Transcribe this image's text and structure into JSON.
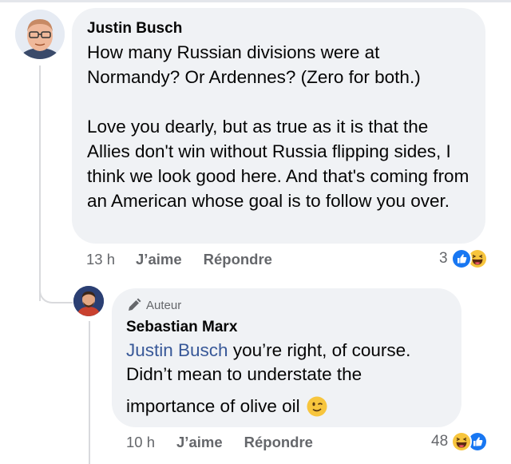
{
  "comments": [
    {
      "author": "Justin Busch",
      "paragraphs": [
        "How many Russian divisions were at Normandy? Or Ardennes? (Zero for both.)",
        "Love you dearly, but as true as it is that the Allies don't win without Russia flipping sides, I think we look good here. And that's coming from an American whose goal is to follow you over."
      ],
      "time": "13 h",
      "like_label": "J’aime",
      "reply_label": "Répondre",
      "reaction_count": "3",
      "reactions": [
        "like-icon",
        "haha-icon"
      ]
    }
  ],
  "reply": {
    "badge": "Auteur",
    "badge_icon": "pencil-icon",
    "author": "Sebastian Marx",
    "mention": "Justin Busch",
    "text_line1": " you’re right, of course.",
    "text_line2": "Didn’t mean to understate the",
    "text_line3": "importance of olive oil",
    "emoji": "wink-emoji-icon",
    "time": "10 h",
    "like_label": "J’aime",
    "reply_label": "Répondre",
    "reaction_count": "48",
    "reactions": [
      "haha-icon",
      "like-icon"
    ]
  },
  "colors": {
    "bubble": "#f0f2f5",
    "meta_text": "#65676b",
    "mention": "#385898",
    "like_blue": "#1877f2",
    "haha_yellow": "#f7c53d"
  }
}
